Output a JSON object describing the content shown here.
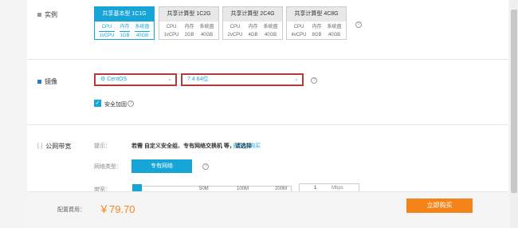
{
  "instance": {
    "label": "实例",
    "cards": [
      {
        "title": "共享基本型 1C1G",
        "selected": true,
        "spec_labels": [
          "CPU",
          "内存",
          "系统盘"
        ],
        "spec_values": [
          "1vCPU",
          "1GB",
          "40GB"
        ]
      },
      {
        "title": "共享计算型 1C2G",
        "selected": false,
        "spec_labels": [
          "CPU",
          "内存",
          "系统盘"
        ],
        "spec_values": [
          "1vCPU",
          "2GB",
          "40GB"
        ]
      },
      {
        "title": "共享计算型 2C4G",
        "selected": false,
        "spec_labels": [
          "CPU",
          "内存",
          "系统盘"
        ],
        "spec_values": [
          "2vCPU",
          "4GB",
          "40GB"
        ]
      },
      {
        "title": "共享计算型 4C8G",
        "selected": false,
        "spec_labels": [
          "CPU",
          "内存",
          "系统盘"
        ],
        "spec_values": [
          "4vCPU",
          "8GB",
          "40GB"
        ]
      }
    ]
  },
  "image": {
    "label": "镜像",
    "os_value": "CentOS",
    "version_value": "7.4 64位",
    "security_label": "安全加固"
  },
  "bandwidth": {
    "label": "公网带宽",
    "hint_label": "提示：",
    "hint_text": "若需 自定义安全组、专有网络交换机 等，请选择",
    "hint_link": "自定义购买",
    "network_label": "网络类型：",
    "network_button": "专有网络",
    "bandwidth_label": "带宽：",
    "ticks": [
      "50M",
      "100M",
      "200M"
    ],
    "value": "1",
    "unit": "Mbps"
  },
  "footer": {
    "fee_label": "配置费用：",
    "price": "￥79.70",
    "buy_button": "立即购买"
  },
  "colors": {
    "accent": "#17a5d8",
    "price": "#f58418",
    "highlight_border": "#b53a3a"
  }
}
